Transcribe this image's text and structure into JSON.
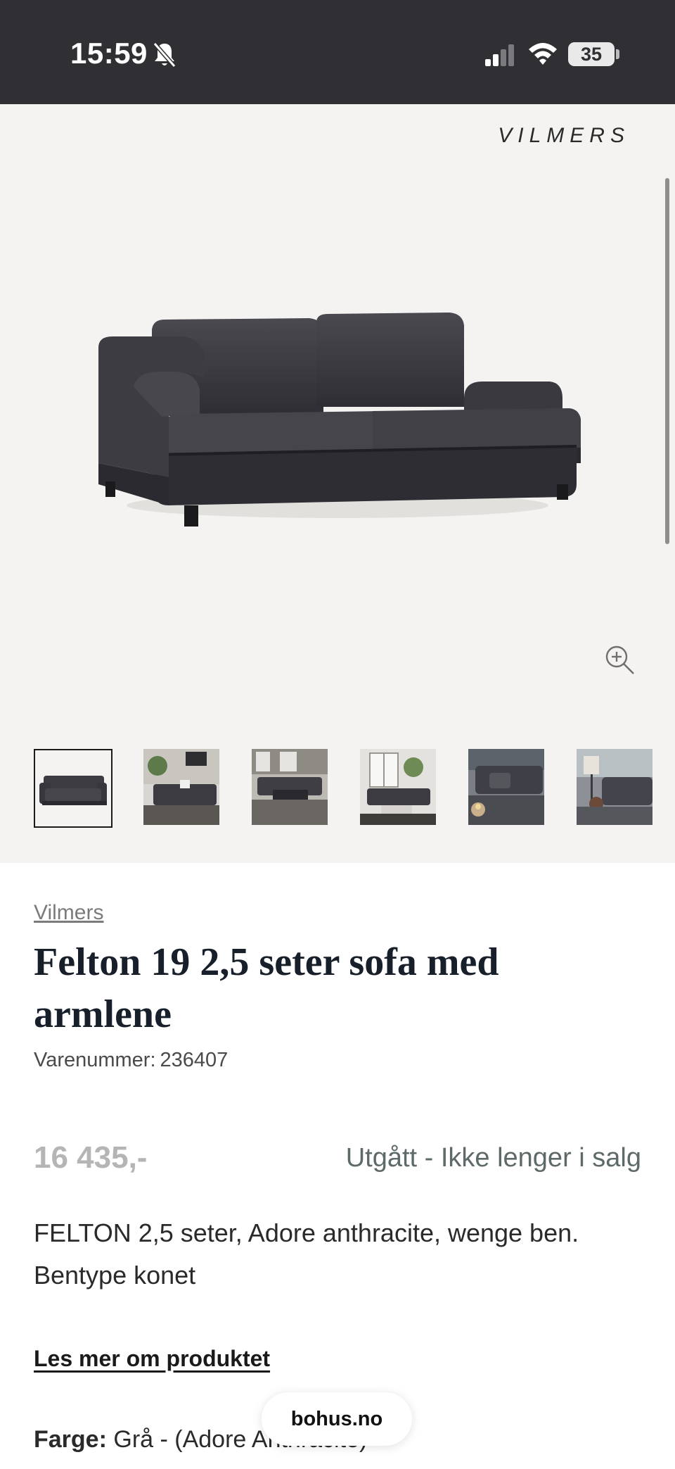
{
  "status_bar": {
    "time": "15:59",
    "battery_level": "35",
    "icons": [
      "bell-slash-icon",
      "cellular-signal-icon",
      "wifi-icon",
      "battery-icon"
    ]
  },
  "gallery": {
    "brand_logo": "VILMERS",
    "main_image": "sofa-product-image",
    "thumbnails": [
      {
        "name": "sofa-studio",
        "active": true
      },
      {
        "name": "living-room-plant",
        "active": false
      },
      {
        "name": "living-room-rug",
        "active": false
      },
      {
        "name": "living-room-window",
        "active": false
      },
      {
        "name": "sofa-closeup-candle",
        "active": false
      },
      {
        "name": "sofa-lamp-corner",
        "active": false
      }
    ],
    "zoom_icon": "zoom-in-icon"
  },
  "product": {
    "vendor": "Vilmers",
    "title": "Felton 19 2,5 seter sofa med armlene",
    "sku_label": "Varenummer:",
    "sku_value": "236407",
    "price": "16 435,-",
    "availability": "Utgått - Ikke lenger i salg",
    "description": "FELTON 2,5 seter, Adore anthracite, wenge ben. Bentype konet",
    "read_more": "Les mer om produktet",
    "color_label": "Farge:",
    "color_value": "Grå - (Adore Anthracite)"
  },
  "browser": {
    "url": "bohus.no"
  },
  "colors": {
    "status_bar_bg": "#2f2f34",
    "gallery_bg": "#f4f3f1",
    "sofa_fabric": "#3b3a40",
    "price_muted": "#b5b5b5",
    "availability_text": "#5e6a6a"
  }
}
